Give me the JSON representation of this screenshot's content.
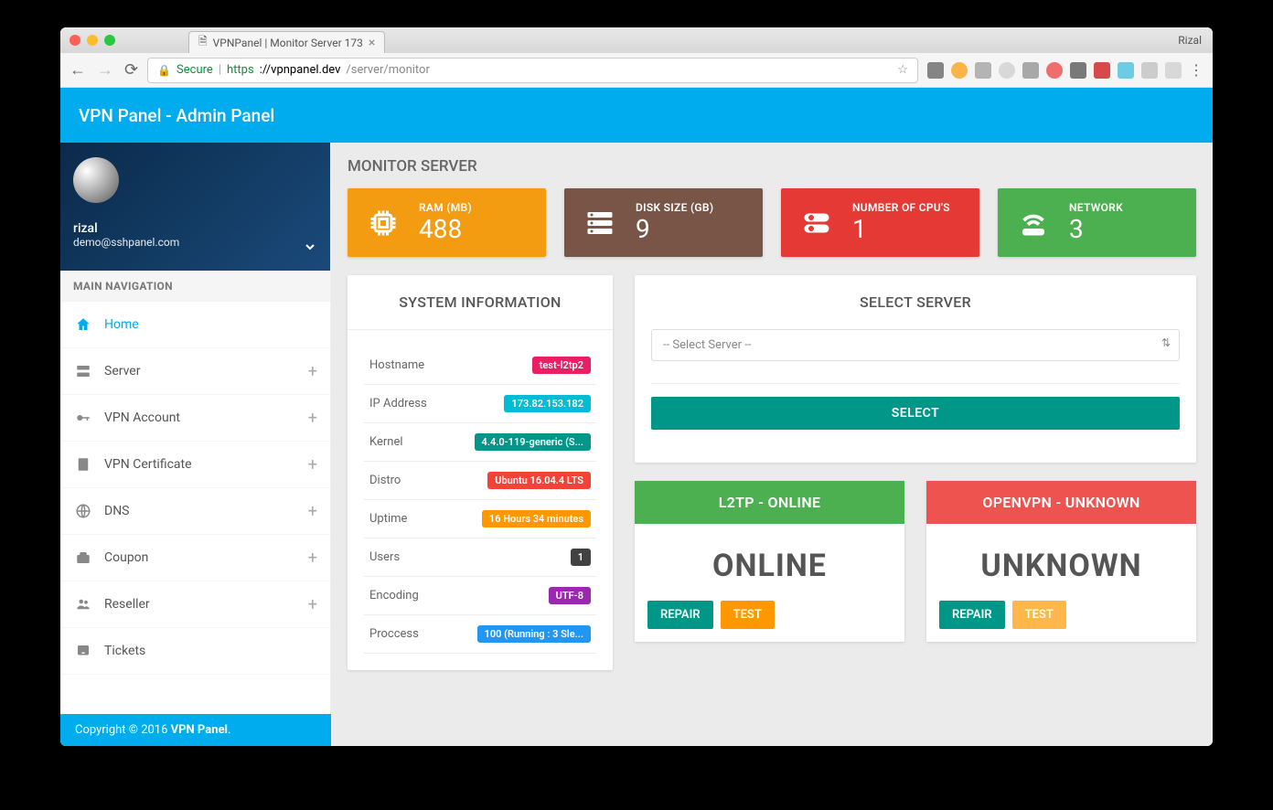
{
  "browser": {
    "tab_title": "VPNPanel | Monitor Server 173",
    "profile": "Rizal",
    "secure_label": "Secure",
    "url_proto": "https",
    "url_host": "://vpnpanel.dev",
    "url_path": "/server/monitor"
  },
  "header": {
    "title": "VPN Panel - Admin Panel"
  },
  "user": {
    "name": "rizal",
    "email": "demo@sshpanel.com"
  },
  "nav": {
    "section": "MAIN NAVIGATION",
    "items": [
      {
        "label": "Home",
        "expandable": false
      },
      {
        "label": "Server",
        "expandable": true
      },
      {
        "label": "VPN Account",
        "expandable": true
      },
      {
        "label": "VPN Certificate",
        "expandable": true
      },
      {
        "label": "DNS",
        "expandable": true
      },
      {
        "label": "Coupon",
        "expandable": true
      },
      {
        "label": "Reseller",
        "expandable": true
      },
      {
        "label": "Tickets",
        "expandable": false
      }
    ]
  },
  "page": {
    "title": "MONITOR SERVER"
  },
  "stats": {
    "ram": {
      "label": "RAM (MB)",
      "value": "488"
    },
    "disk": {
      "label": "DISK SIZE (GB)",
      "value": "9"
    },
    "cpu": {
      "label": "NUMBER OF CPU'S",
      "value": "1"
    },
    "net": {
      "label": "NETWORK",
      "value": "3"
    }
  },
  "sysinfo": {
    "title": "SYSTEM INFORMATION",
    "rows": [
      {
        "label": "Hostname",
        "value": "test-l2tp2",
        "color": "b-pink"
      },
      {
        "label": "IP Address",
        "value": "173.82.153.182",
        "color": "b-teal"
      },
      {
        "label": "Kernel",
        "value": "4.4.0-119-generic (S...",
        "color": "b-green"
      },
      {
        "label": "Distro",
        "value": "Ubuntu 16.04.4 LTS",
        "color": "b-red"
      },
      {
        "label": "Uptime",
        "value": "16 Hours 34 minutes",
        "color": "b-orange"
      },
      {
        "label": "Users",
        "value": "1",
        "color": "b-dark"
      },
      {
        "label": "Encoding",
        "value": "UTF-8",
        "color": "b-purple"
      },
      {
        "label": "Proccess",
        "value": "100 (Running : 3 Sle...",
        "color": "b-blue"
      }
    ]
  },
  "select_server": {
    "title": "SELECT SERVER",
    "placeholder": "-- Select Server --",
    "button": "SELECT"
  },
  "services": {
    "l2tp": {
      "header": "L2TP - ONLINE",
      "status": "ONLINE",
      "repair": "REPAIR",
      "test": "TEST"
    },
    "openvpn": {
      "header": "OPENVPN - UNKNOWN",
      "status": "UNKNOWN",
      "repair": "REPAIR",
      "test": "TEST"
    }
  },
  "footer": {
    "prefix": "Copyright © 2016 ",
    "brand": "VPN Panel",
    "suffix": "."
  }
}
